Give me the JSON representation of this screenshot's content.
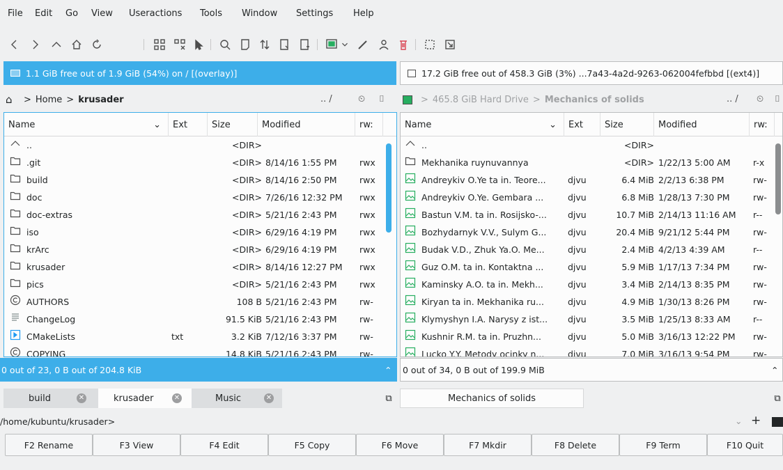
{
  "menu": [
    "File",
    "Edit",
    "Go",
    "View",
    "Useractions",
    "Tools",
    "Window",
    "Settings",
    "Help"
  ],
  "free_left": "1.1 GiB free out of 1.9 GiB (54%) on / [(overlay)]",
  "free_right": "17.2 GiB free out of 458.3 GiB (3%) ...7a43-4a2d-9263-062004fefbbd [(ext4)]",
  "path_left": {
    "home": "Home",
    "sep": ">",
    "current": "krusader",
    "tools": ".. /"
  },
  "path_right": {
    "drive": "465.8 GiB Hard Drive",
    "sep": ">",
    "current": "Mechanics of solids",
    "tools": ".. /"
  },
  "columns": {
    "name": "Name",
    "ext": "Ext",
    "size": "Size",
    "modified": "Modified",
    "rwx": "rw:"
  },
  "left_rows": [
    {
      "name": "..",
      "ext": "",
      "size": "<DIR>",
      "modified": "",
      "rwx": "",
      "icon": "up"
    },
    {
      "name": ".git",
      "ext": "",
      "size": "<DIR>",
      "modified": "8/14/16 1:55 PM",
      "rwx": "rwx",
      "icon": "folder"
    },
    {
      "name": "build",
      "ext": "",
      "size": "<DIR>",
      "modified": "8/14/16 2:50 PM",
      "rwx": "rwx",
      "icon": "folder"
    },
    {
      "name": "doc",
      "ext": "",
      "size": "<DIR>",
      "modified": "7/26/16 12:32 PM",
      "rwx": "rwx",
      "icon": "folder"
    },
    {
      "name": "doc-extras",
      "ext": "",
      "size": "<DIR>",
      "modified": "5/21/16 2:43 PM",
      "rwx": "rwx",
      "icon": "folder"
    },
    {
      "name": "iso",
      "ext": "",
      "size": "<DIR>",
      "modified": "6/29/16 4:19 PM",
      "rwx": "rwx",
      "icon": "folder"
    },
    {
      "name": "krArc",
      "ext": "",
      "size": "<DIR>",
      "modified": "6/29/16 4:19 PM",
      "rwx": "rwx",
      "icon": "folder"
    },
    {
      "name": "krusader",
      "ext": "",
      "size": "<DIR>",
      "modified": "8/14/16 12:27 PM",
      "rwx": "rwx",
      "icon": "folder"
    },
    {
      "name": "pics",
      "ext": "",
      "size": "<DIR>",
      "modified": "5/21/16 2:43 PM",
      "rwx": "rwx",
      "icon": "folder"
    },
    {
      "name": "AUTHORS",
      "ext": "",
      "size": "108 B",
      "modified": "5/21/16 2:43 PM",
      "rwx": "rw-",
      "icon": "copyright"
    },
    {
      "name": "ChangeLog",
      "ext": "",
      "size": "91.5 KiB",
      "modified": "5/21/16 2:43 PM",
      "rwx": "rw-",
      "icon": "text"
    },
    {
      "name": "CMakeLists",
      "ext": "txt",
      "size": "3.2 KiB",
      "modified": "7/12/16 3:37 PM",
      "rwx": "rw-",
      "icon": "cmake"
    },
    {
      "name": "COPYING",
      "ext": "",
      "size": "14.8 KiB",
      "modified": "5/21/16 2:43 PM",
      "rwx": "rw-",
      "icon": "copyright"
    }
  ],
  "right_rows": [
    {
      "name": "..",
      "ext": "",
      "size": "<DIR>",
      "modified": "",
      "rwx": "",
      "icon": "up"
    },
    {
      "name": "Mekhanika ruynuvannya",
      "ext": "",
      "size": "<DIR>",
      "modified": "1/22/13 5:00 AM",
      "rwx": "r-x",
      "icon": "folder"
    },
    {
      "name": "Andreykiv O.Ye ta in. Teore...",
      "ext": "djvu",
      "size": "6.4 MiB",
      "modified": "2/2/13 6:38 PM",
      "rwx": "rw-",
      "icon": "image"
    },
    {
      "name": "Andreykiv O.Ye. Gembara ...",
      "ext": "djvu",
      "size": "6.8 MiB",
      "modified": "1/28/13 7:30 PM",
      "rwx": "rw-",
      "icon": "image"
    },
    {
      "name": "Bastun V.M. ta in. Rosijsko-...",
      "ext": "djvu",
      "size": "10.7 MiB",
      "modified": "2/14/13 11:16 AM",
      "rwx": "r--",
      "icon": "image"
    },
    {
      "name": "Bozhydarnyk V.V., Sulym G...",
      "ext": "djvu",
      "size": "20.4 MiB",
      "modified": "9/21/12 5:44 PM",
      "rwx": "rw-",
      "icon": "image"
    },
    {
      "name": "Budak V.D., Zhuk Ya.O. Me...",
      "ext": "djvu",
      "size": "2.4 MiB",
      "modified": "4/2/13 4:39 AM",
      "rwx": "r--",
      "icon": "image"
    },
    {
      "name": "Guz O.M. ta in. Kontaktna ...",
      "ext": "djvu",
      "size": "5.9 MiB",
      "modified": "1/17/13 7:34 PM",
      "rwx": "rw-",
      "icon": "image"
    },
    {
      "name": "Kaminsky A.O. ta in. Mekh...",
      "ext": "djvu",
      "size": "3.4 MiB",
      "modified": "2/14/13 8:35 PM",
      "rwx": "rw-",
      "icon": "image"
    },
    {
      "name": "Kiryan ta in. Mekhanika ru...",
      "ext": "djvu",
      "size": "4.9 MiB",
      "modified": "1/30/13 8:26 PM",
      "rwx": "rw-",
      "icon": "image"
    },
    {
      "name": "Klymyshyn I.A. Narysy z ist...",
      "ext": "djvu",
      "size": "3.5 MiB",
      "modified": "1/25/13 8:33 AM",
      "rwx": "r--",
      "icon": "image"
    },
    {
      "name": "Kushnir R.M. ta in. Pruzhn...",
      "ext": "djvu",
      "size": "5.0 MiB",
      "modified": "3/16/13 12:22 PM",
      "rwx": "rw-",
      "icon": "image"
    },
    {
      "name": "Lucko Y.Y. Metody ocinky n...",
      "ext": "djvu",
      "size": "7.0 MiB",
      "modified": "3/16/13 9:54 PM",
      "rwx": "rw-",
      "icon": "image"
    }
  ],
  "status_left": "0 out of 23, 0 B out of 204.8 KiB",
  "status_right": "0 out of 34, 0 B out of 199.9 MiB",
  "tabs_left": [
    "build",
    "krusader",
    "Music"
  ],
  "tabs_right": [
    "Mechanics of solids"
  ],
  "cmdline": "/home/kubuntu/krusader>",
  "fkeys": [
    "F2 Rename",
    "F3 View",
    "F4 Edit",
    "F5 Copy",
    "F6 Move",
    "F7 Mkdir",
    "F8 Delete",
    "F9 Term",
    "F10 Quit"
  ],
  "colors": {
    "accent": "#3daee9",
    "folder": "#4d4d4d",
    "image": "#27ae60"
  }
}
